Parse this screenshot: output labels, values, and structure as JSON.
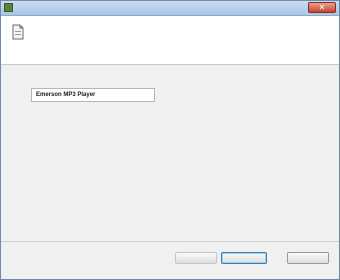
{
  "window": {
    "title": "",
    "close_glyph": "✕"
  },
  "header": {
    "heading": "",
    "subtitle_left": "",
    "subtitle_right": "",
    "icon": "document-icon"
  },
  "form": {
    "name_label": "",
    "name_value": "Emerson MP3 Player",
    "description": ""
  },
  "footer": {
    "privacy_link": "",
    "back_label": "",
    "next_label": "",
    "cancel_label": ""
  },
  "colors": {
    "title_bar": "#a9c6e6",
    "close_button": "#c64530",
    "link": "#3a66b5"
  }
}
